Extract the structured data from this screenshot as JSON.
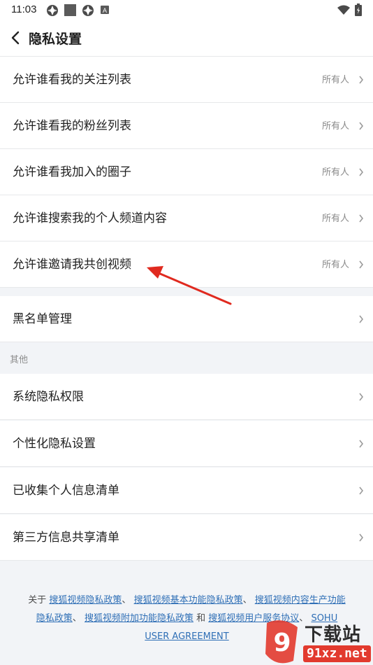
{
  "status_bar": {
    "time": "11:03",
    "icons": [
      "app-icon-1",
      "app-icon-2",
      "app-icon-3",
      "a-icon",
      "wifi-icon",
      "battery-icon"
    ]
  },
  "header": {
    "back_icon": "chevron-left-icon",
    "title": "隐私设置"
  },
  "privacy_rows": [
    {
      "label": "允许谁看我的关注列表",
      "value": "所有人"
    },
    {
      "label": "允许谁看我的粉丝列表",
      "value": "所有人"
    },
    {
      "label": "允许谁看我加入的圈子",
      "value": "所有人"
    },
    {
      "label": "允许谁搜索我的个人频道内容",
      "value": "所有人"
    },
    {
      "label": "允许谁邀请我共创视频",
      "value": "所有人"
    }
  ],
  "blacklist_row": {
    "label": "黑名单管理"
  },
  "other_section": {
    "title": "其他",
    "items": [
      {
        "label": "系统隐私权限"
      },
      {
        "label": "个性化隐私设置"
      },
      {
        "label": "已收集个人信息清单"
      },
      {
        "label": "第三方信息共享清单"
      }
    ]
  },
  "footer": {
    "prefix": "关于",
    "link1": "搜狐视频隐私政策",
    "sep1": "、",
    "link2": "搜狐视频基本功能隐私政策",
    "sep2": "、",
    "link3": "搜狐视频内容生产功能隐私政策",
    "sep3": "、",
    "link4": "搜狐视频附加功能隐私政策",
    "and": "和",
    "link5": "搜狐视频用户服务协议",
    "sep4": "、",
    "link6": "SOHU USER AGREEMENT"
  },
  "watermark": {
    "text": "下载站",
    "url": "91xz.net"
  },
  "colors": {
    "background": "#f2f4f7",
    "card": "#ffffff",
    "link": "#2f6fb6",
    "annotation_arrow": "#e02a1f",
    "secondary_text": "#8a8a8a"
  }
}
